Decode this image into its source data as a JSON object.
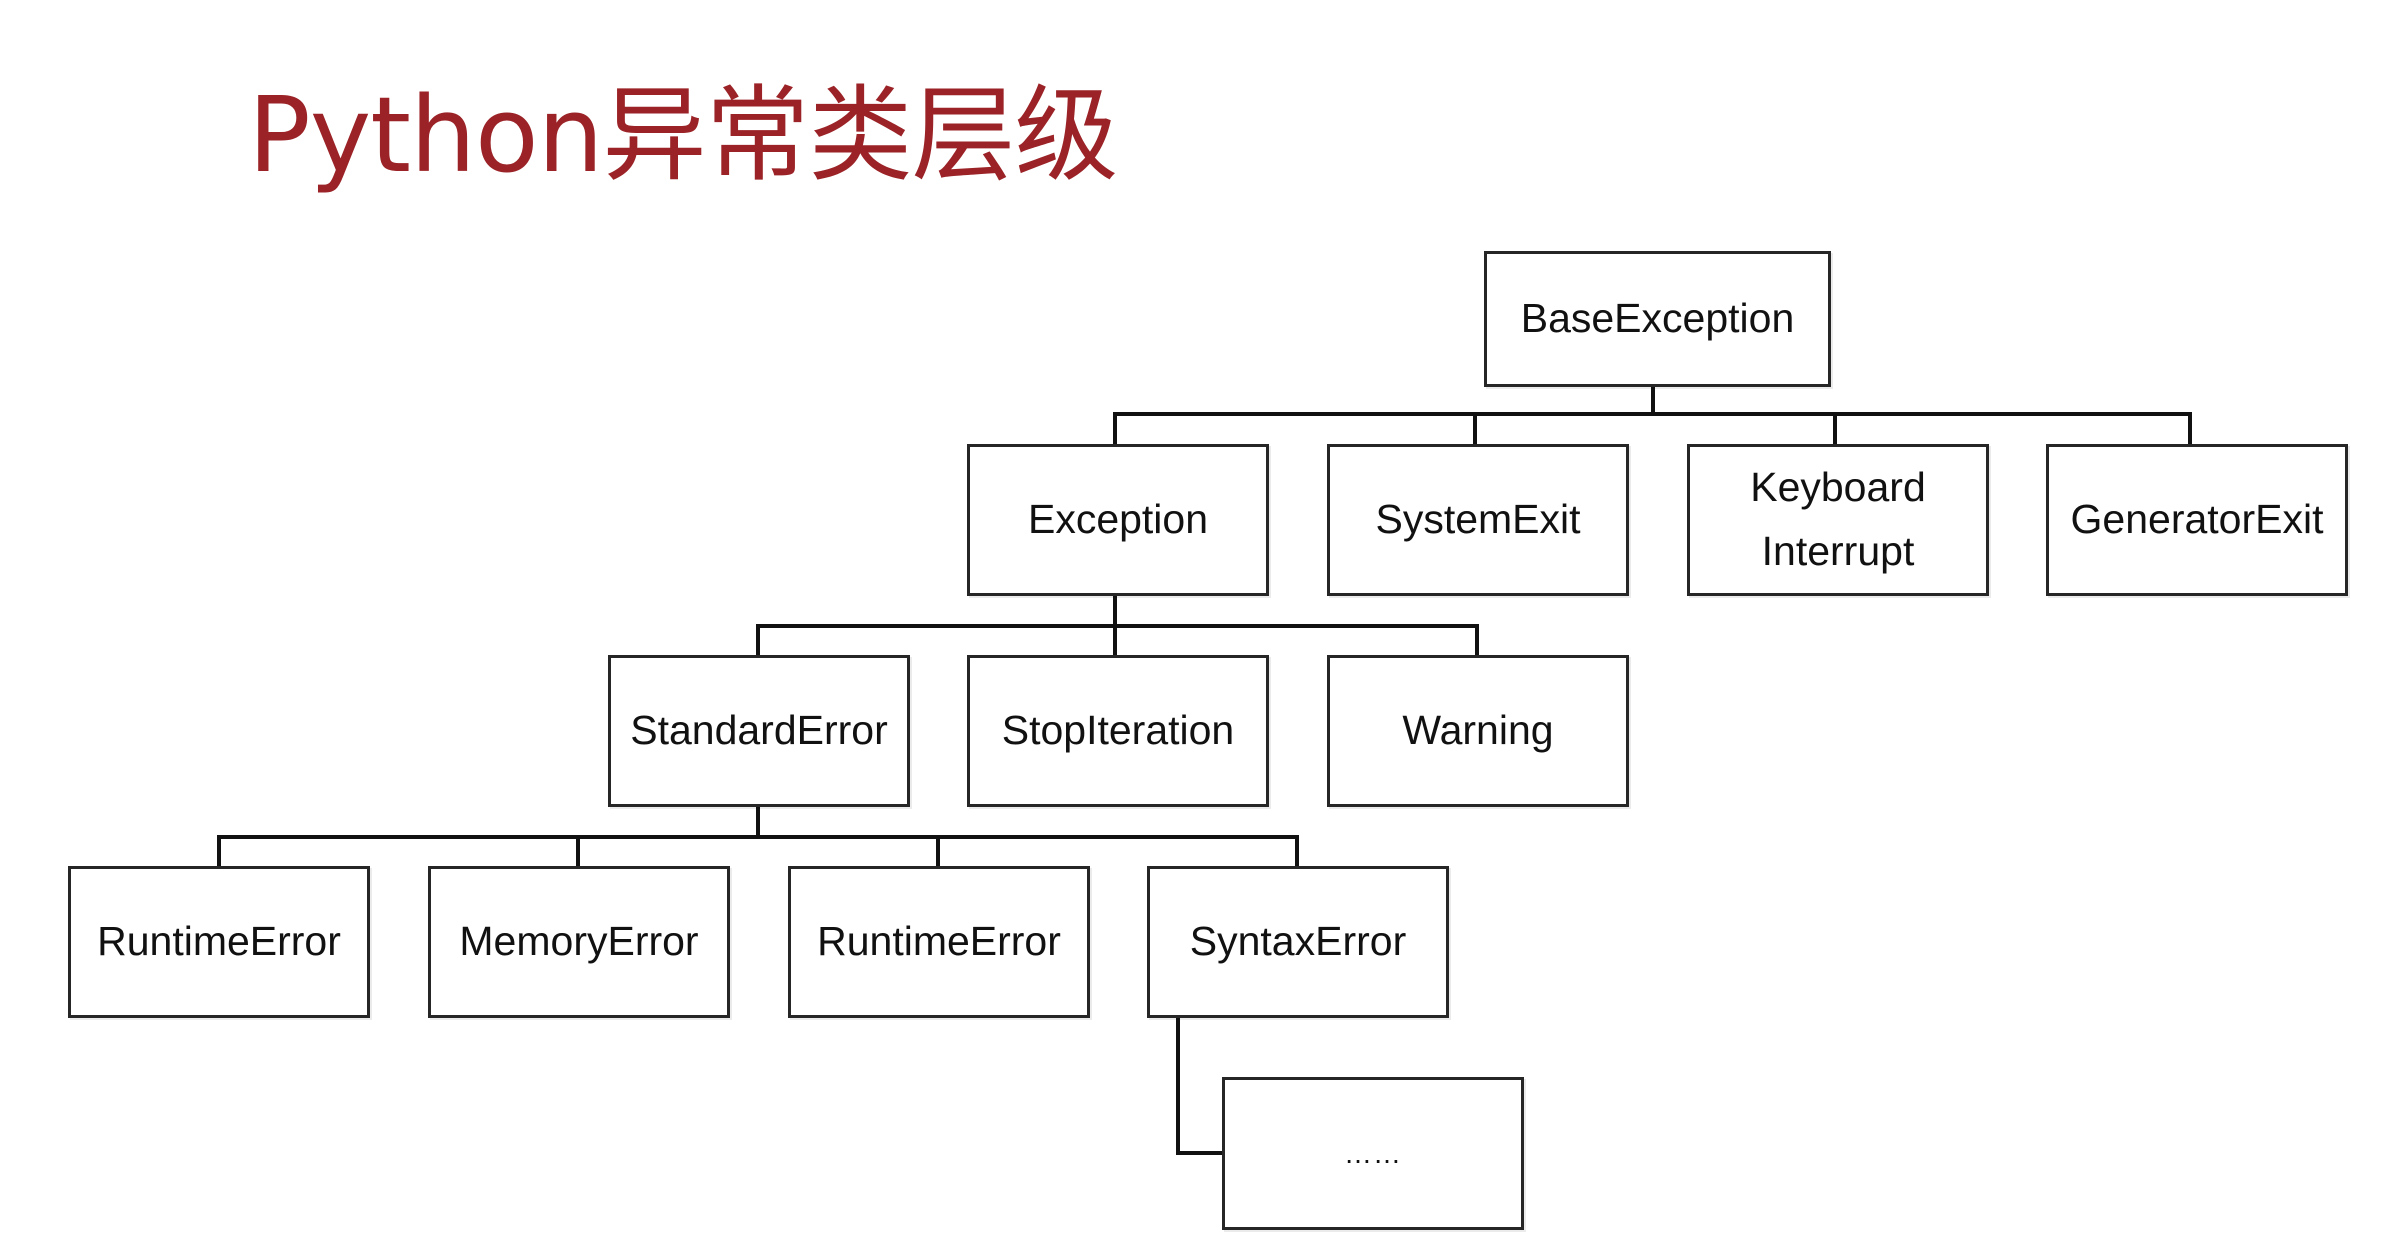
{
  "title": "Python异常类层级",
  "colors": {
    "title": "#9b2226",
    "border": "#262626",
    "line": "#111111"
  },
  "nodes": {
    "base_exception": "BaseException",
    "exception": "Exception",
    "system_exit": "SystemExit",
    "keyboard_interrupt": "Keyboard\nInterrupt",
    "generator_exit": "GeneratorExit",
    "standard_error": "StandardError",
    "stop_iteration": "StopIteration",
    "warning": "Warning",
    "runtime_error_1": "RuntimeError",
    "memory_error": "MemoryError",
    "runtime_error_2": "RuntimeError",
    "syntax_error": "SyntaxError",
    "more": "……"
  }
}
